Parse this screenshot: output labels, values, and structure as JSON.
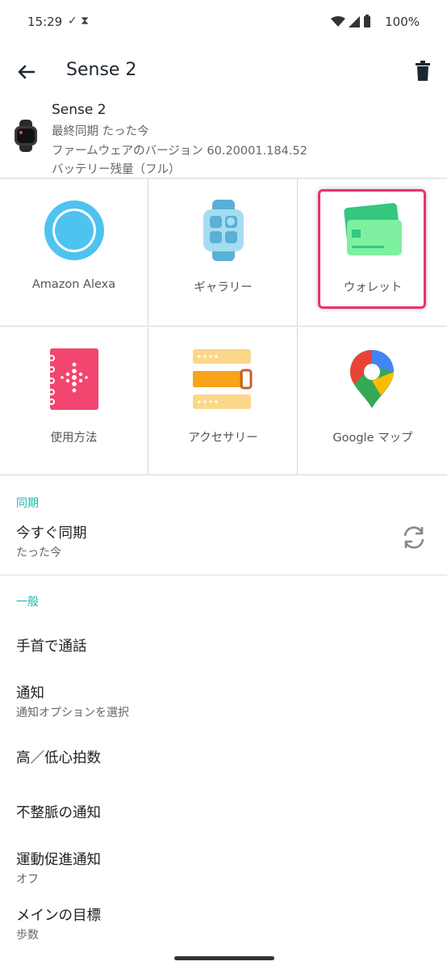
{
  "status_bar": {
    "time": "15:29",
    "left_icons": "✓ ⧗",
    "battery": "100%"
  },
  "app_bar": {
    "title": "Sense 2"
  },
  "device": {
    "name": "Sense 2",
    "last_sync": "最終同期 たった今",
    "firmware": "ファームウェアのバージョン 60.20001.184.52",
    "battery": "バッテリー残量（フル）"
  },
  "apps": [
    {
      "label": "Amazon Alexa"
    },
    {
      "label": "ギャラリー"
    },
    {
      "label": "ウォレット"
    },
    {
      "label": "使用方法"
    },
    {
      "label": "アクセサリー"
    },
    {
      "label": "Google マップ"
    }
  ],
  "sync_section": {
    "header": "同期",
    "item": "今すぐ同期",
    "sub": "たった今"
  },
  "general_section": {
    "header": "一般",
    "items": [
      {
        "label": "手首で通話"
      },
      {
        "label": "通知",
        "sub": "通知オプションを選択"
      },
      {
        "label": "高／低心拍数"
      },
      {
        "label": "不整脈の通知"
      },
      {
        "label": "運動促進通知",
        "sub": "オフ"
      },
      {
        "label": "メインの目標",
        "sub": "歩数"
      }
    ]
  },
  "colors": {
    "accent": "#1fb7b0",
    "highlight": "#e8336d"
  }
}
